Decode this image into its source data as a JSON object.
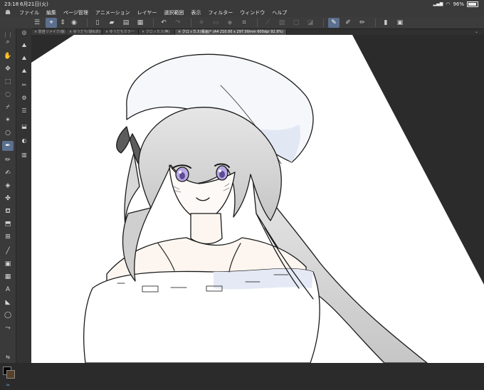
{
  "status": {
    "time": "23:18",
    "date": "6月21日(火)",
    "battery": "96%"
  },
  "menu": [
    "ファイル",
    "編集",
    "ページ管理",
    "アニメーション",
    "レイヤー",
    "選択範囲",
    "表示",
    "フィルター",
    "ウィンドウ",
    "ヘルプ"
  ],
  "tabs": [
    {
      "label": "防自リメイク(仮)"
    },
    {
      "label": "ゆうだち(疑似的)"
    },
    {
      "label": "ゆうだちカラー"
    },
    {
      "label": "クロッカス(無)"
    },
    {
      "label": "クロッカス(版画)* (A4 210.00 x 297.00mm 600dpi 92.9%)"
    }
  ],
  "icons": {
    "logo": "clip-studio-logo-icon",
    "wifi": "wifi-icon",
    "tab_close": "close-icon",
    "tabs_menu": "chevron-down-icon"
  },
  "colors": {
    "accent": "#5b6f8e",
    "foreground_color": "#000000",
    "background_color": "#5a4028"
  }
}
